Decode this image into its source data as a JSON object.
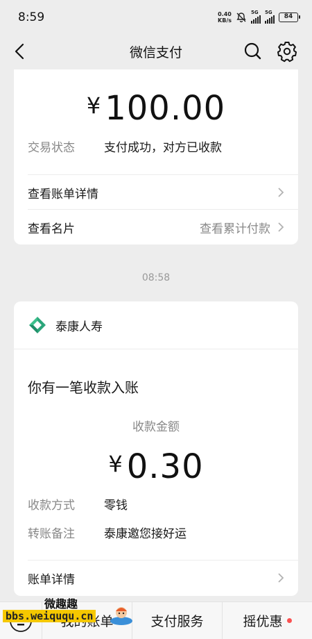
{
  "status_bar": {
    "time": "8:59",
    "net_speed_value": "0.40",
    "net_speed_unit": "KB/s",
    "signal1_label": "5G",
    "signal2_label": "5G",
    "battery": "84"
  },
  "nav": {
    "title": "微信支付"
  },
  "payment_card": {
    "currency": "¥",
    "amount": "100.00",
    "status_label": "交易状态",
    "status_value": "支付成功，对方已收款",
    "bill_detail_label": "查看账单详情",
    "card_label": "查看名片",
    "cumulative_label": "查看累计付款"
  },
  "timestamp": "08:58",
  "receipt_card": {
    "brand_name": "泰康人寿",
    "notice": "你有一笔收款入账",
    "amount_label": "收款金额",
    "currency": "¥",
    "amount": "0.30",
    "method_label": "收款方式",
    "method_value": "零钱",
    "remark_label": "转账备注",
    "remark_value": "泰康邀您接好运",
    "bill_detail_label": "账单详情"
  },
  "bottom_menu": {
    "items": [
      "我的账单",
      "支付服务",
      "摇优惠"
    ]
  },
  "watermark": {
    "title": "微趣趣",
    "url": "bbs.weiququ.cn"
  },
  "colors": {
    "background": "#ededed",
    "card": "#ffffff",
    "brand_green": "#2ba57a",
    "red_dot": "#fa5151"
  }
}
